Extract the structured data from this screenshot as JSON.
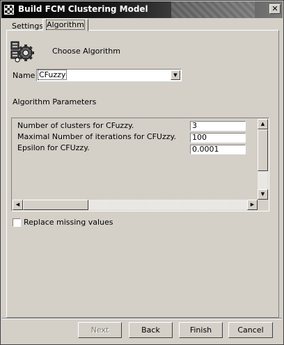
{
  "window": {
    "title": "Build FCM Clustering Model",
    "close_symbol": "✕"
  },
  "tabs": [
    {
      "label": "Settings",
      "selected": false
    },
    {
      "label": "Algorithm",
      "selected": true
    }
  ],
  "header": {
    "icon": "algorithm-gear-icon",
    "label": "Choose Algorithm"
  },
  "name_field": {
    "label": "Name",
    "value": "CFuzzy"
  },
  "parameters": {
    "label": "Algorithm Parameters",
    "rows": [
      {
        "label": "Number of clusters for CFuzzy.",
        "value": "3"
      },
      {
        "label": "Maximal Number of iterations for CFUzzy.",
        "value": "100"
      },
      {
        "label": "Epsilon for CFUzzy.",
        "value": "0.0001"
      }
    ]
  },
  "replace_missing": {
    "label": "Replace missing values",
    "checked": false
  },
  "buttons": {
    "next": "Next",
    "back": "Back",
    "finish": "Finish",
    "cancel": "Cancel"
  }
}
